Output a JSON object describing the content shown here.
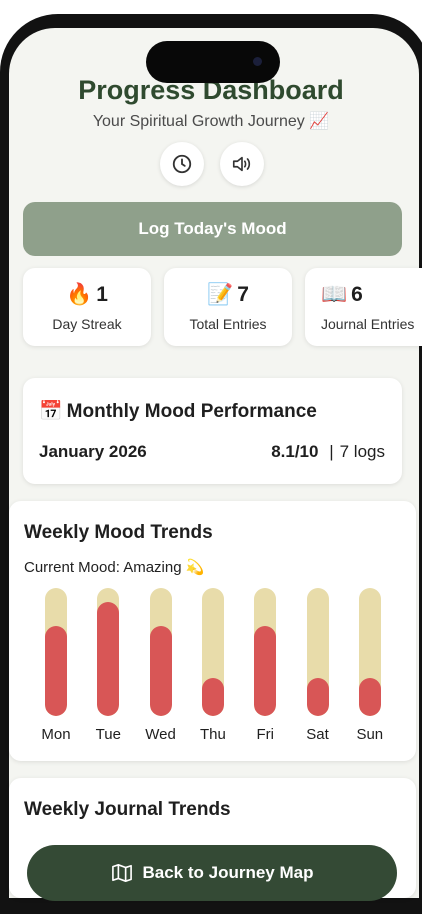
{
  "header": {
    "title": "Progress Dashboard",
    "subtitle": "Your Spiritual Growth Journey 📈"
  },
  "header_icons": [
    "clock-icon",
    "speaker-icon"
  ],
  "log_button": {
    "label": "Log Today's Mood"
  },
  "stats": [
    {
      "emoji": "🔥",
      "value": "1",
      "label": "Day Streak"
    },
    {
      "emoji": "📝",
      "value": "7",
      "label": "Total Entries"
    },
    {
      "emoji": "📖",
      "value": "6",
      "label": "Journal Entries"
    }
  ],
  "monthly": {
    "emoji": "📅",
    "title": "Monthly Mood Performance",
    "month": "January 2026",
    "score": "8.1/10",
    "separator": "|",
    "logs": "7 logs"
  },
  "weekly_mood": {
    "title": "Weekly Mood Trends",
    "current_mood": "Current Mood: Amazing 💫",
    "colors": {
      "track": "#e8dcaa",
      "fill": "#d85656"
    },
    "days": [
      {
        "label": "Mon",
        "level": 0.7
      },
      {
        "label": "Tue",
        "level": 0.89
      },
      {
        "label": "Wed",
        "level": 0.7
      },
      {
        "label": "Thu",
        "level": 0.3
      },
      {
        "label": "Fri",
        "level": 0.7
      },
      {
        "label": "Sat",
        "level": 0.3
      },
      {
        "label": "Sun",
        "level": 0.3
      }
    ]
  },
  "weekly_journal": {
    "title": "Weekly Journal Trends"
  },
  "back_button": {
    "label": "Back to Journey Map",
    "icon": "map-icon"
  },
  "colors": {
    "accent": "#2f4a2f",
    "button": "#8fa08b",
    "dark_button": "#344a35"
  }
}
